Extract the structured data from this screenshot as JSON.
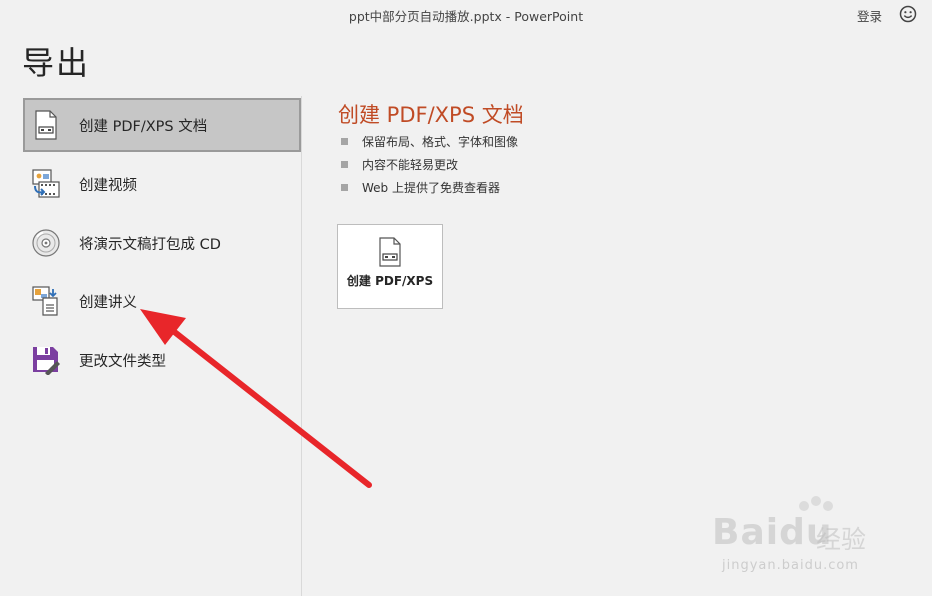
{
  "window": {
    "title": "ppt中部分页自动播放.pptx  -  PowerPoint",
    "signin": "登录"
  },
  "page": {
    "title": "导出"
  },
  "nav": {
    "items": [
      {
        "label": "创建 PDF/XPS 文档",
        "icon": "pdf-document-icon",
        "selected": true
      },
      {
        "label": "创建视频",
        "icon": "video-icon",
        "selected": false
      },
      {
        "label": "将演示文稿打包成 CD",
        "icon": "cd-icon",
        "selected": false
      },
      {
        "label": "创建讲义",
        "icon": "handout-icon",
        "selected": false
      },
      {
        "label": "更改文件类型",
        "icon": "save-disk-icon",
        "selected": false
      }
    ]
  },
  "detail": {
    "title": "创建 PDF/XPS 文档",
    "bullets": [
      "保留布局、格式、字体和图像",
      "内容不能轻易更改",
      "Web 上提供了免费查看器"
    ],
    "button_label": "创建 PDF/XPS"
  },
  "watermark": {
    "brand": "Bai",
    "brand2": "du",
    "cn": "经验",
    "url": "jingyan.baidu.com"
  },
  "colors": {
    "accent": "#c04b25",
    "selected_bg": "#c6c6c6",
    "arrow": "#e8262a"
  }
}
